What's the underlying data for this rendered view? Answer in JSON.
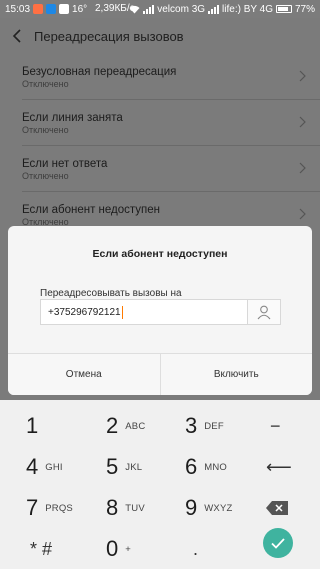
{
  "status_bar": {
    "time": "15:03",
    "notification_count": "16°",
    "speed": "2,39КБ/с",
    "carrier1": "velcom 3G",
    "carrier2": "life:) BY 4G",
    "battery": "77%"
  },
  "header": {
    "title": "Переадресация вызовов",
    "back_icon": "back-arrow-icon"
  },
  "settings": [
    {
      "title": "Безусловная переадресация",
      "status": "Отключено"
    },
    {
      "title": "Если линия занята",
      "status": "Отключено"
    },
    {
      "title": "Если нет ответа",
      "status": "Отключено"
    },
    {
      "title": "Если абонент недоступен",
      "status": "Отключено"
    }
  ],
  "dialog": {
    "title": "Если абонент недоступен",
    "label": "Переадресовывать вызовы на",
    "phone_value": "+375296792121",
    "contact_icon": "person-icon",
    "cancel_label": "Отмена",
    "enable_label": "Включить"
  },
  "keypad": {
    "rows": [
      [
        {
          "num": "1",
          "letters": ""
        },
        {
          "num": "2",
          "letters": "ABC"
        },
        {
          "num": "3",
          "letters": "DEF"
        },
        {
          "sym": "−"
        }
      ],
      [
        {
          "num": "4",
          "letters": "GHI"
        },
        {
          "num": "5",
          "letters": "JKL"
        },
        {
          "num": "6",
          "letters": "MNO"
        },
        {
          "sym": "⟵"
        }
      ],
      [
        {
          "num": "7",
          "letters": "PRQS"
        },
        {
          "num": "8",
          "letters": "TUV"
        },
        {
          "num": "9",
          "letters": "WXYZ"
        },
        {
          "icon": "backspace-icon"
        }
      ],
      [
        {
          "num": "* #",
          "letters": ""
        },
        {
          "num": "0",
          "letters": "+"
        },
        {
          "num": "",
          "letters": "."
        },
        {
          "icon": "confirm-check-icon"
        }
      ]
    ],
    "accent_color": "#3fb39f"
  }
}
